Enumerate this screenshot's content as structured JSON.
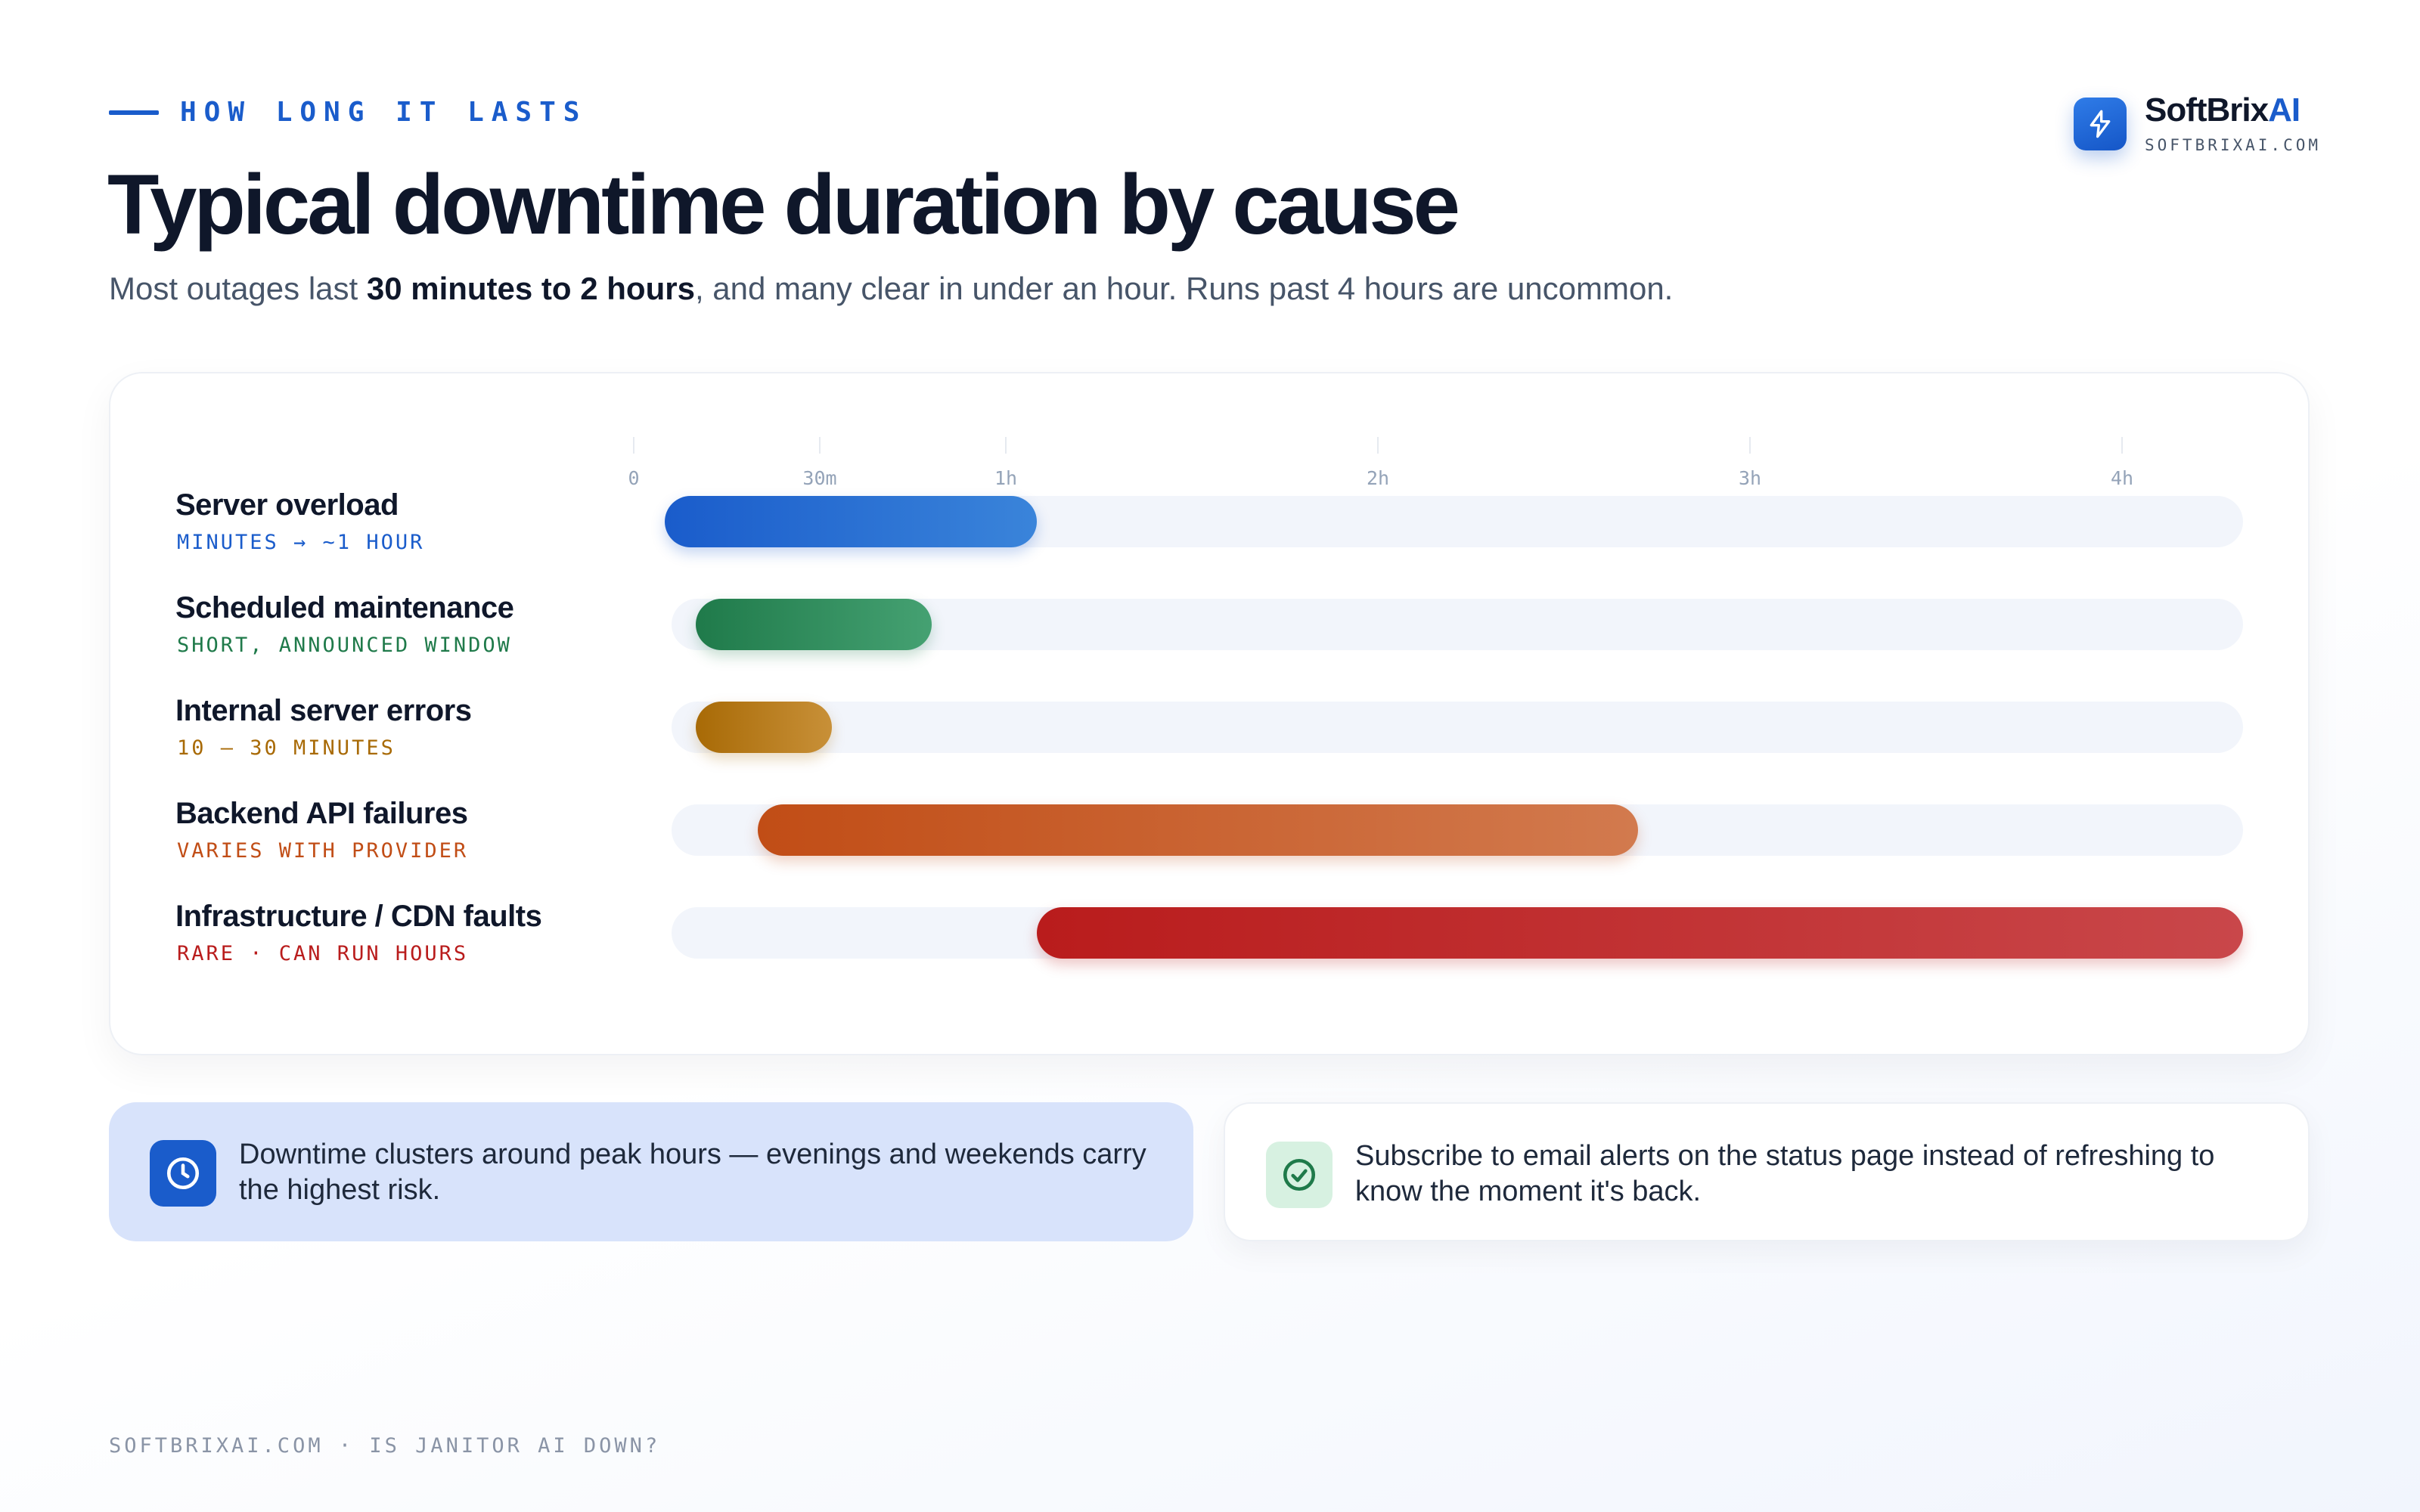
{
  "header": {
    "eyebrow": "HOW LONG IT LASTS",
    "title": "Typical downtime duration by cause",
    "subtitle_before": "Most outages last ",
    "subtitle_bold": "30 minutes to 2 hours",
    "subtitle_after": ", and many clear in under an hour. Runs past 4 hours are uncommon."
  },
  "brand": {
    "name_main": "SoftBrix",
    "name_accent": "AI",
    "url": "SOFTBRIXAI.COM",
    "icon": "lightning-icon"
  },
  "chart_data": {
    "type": "bar",
    "orientation": "horizontal-range",
    "x_unit": "minutes",
    "xlim": [
      0,
      270
    ],
    "x_ticks": [
      {
        "value": 0,
        "label": "0"
      },
      {
        "value": 30,
        "label": "30m"
      },
      {
        "value": 60,
        "label": "1h"
      },
      {
        "value": 120,
        "label": "2h"
      },
      {
        "value": 180,
        "label": "3h"
      },
      {
        "value": 240,
        "label": "4h"
      }
    ],
    "series": [
      {
        "name": "Server overload",
        "note": "MINUTES → ~1 HOUR",
        "start": 5,
        "end": 65,
        "color": "#1a5ccb",
        "color_light": "#3a84da"
      },
      {
        "name": "Scheduled maintenance",
        "note": "SHORT, ANNOUNCED WINDOW",
        "start": 10,
        "end": 48,
        "color": "#1f7a4a",
        "color_light": "#45a172"
      },
      {
        "name": "Internal server errors",
        "note": "10 – 30 MINUTES",
        "start": 10,
        "end": 32,
        "color": "#a86a06",
        "color_light": "#c89038"
      },
      {
        "name": "Backend API failures",
        "note": "VARIES WITH PROVIDER",
        "start": 20,
        "end": 162,
        "color": "#c14d16",
        "color_light": "#d27a4e"
      },
      {
        "name": "Infrastructure / CDN faults",
        "note": "RARE · CAN RUN HOURS",
        "start": 65,
        "end": 283,
        "color": "#b91c1c",
        "color_light": "#c9474a"
      }
    ]
  },
  "callouts": [
    {
      "text": "Downtime clusters around peak hours — evenings and weekends carry the highest risk.",
      "icon": "clock-icon"
    },
    {
      "text": "Subscribe to email alerts on the status page instead of refreshing to know the moment it's back.",
      "icon": "check-circle-icon"
    }
  ],
  "footer": "SOFTBRIXAI.COM · IS JANITOR AI DOWN?"
}
